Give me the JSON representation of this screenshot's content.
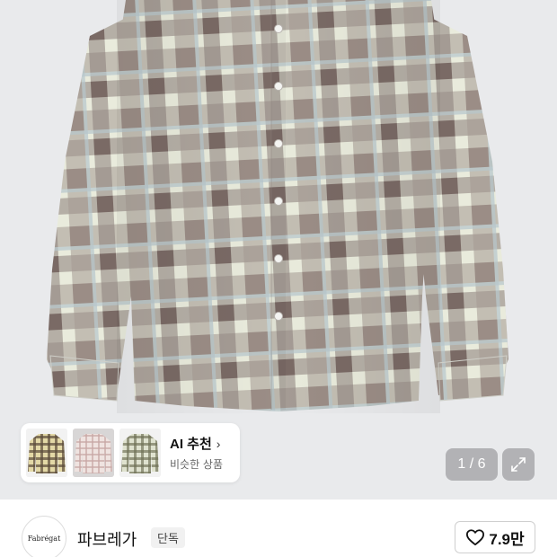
{
  "product": {
    "image_icon": "plaid-shirt-image"
  },
  "ai_recommend": {
    "title": "AI 추천",
    "chevron": "›",
    "subtitle": "비슷한 상품",
    "thumbnails": [
      {
        "icon": "yellow-plaid-shirt"
      },
      {
        "icon": "pink-check-shirt"
      },
      {
        "icon": "green-plaid-shirt"
      }
    ]
  },
  "gallery": {
    "counter": "1 / 6",
    "expand_icon": "expand-icon"
  },
  "brand": {
    "logo_text": "Fabrégat",
    "name": "파브레가",
    "badge": "단독"
  },
  "like": {
    "count": "7.9만",
    "icon": "heart-outline-icon"
  },
  "colors": {
    "hero_bg": "#e9eaec",
    "plaid_brown": "#6e5552",
    "plaid_cream": "#e9ebdc",
    "plaid_blue": "#b7c6cc"
  }
}
